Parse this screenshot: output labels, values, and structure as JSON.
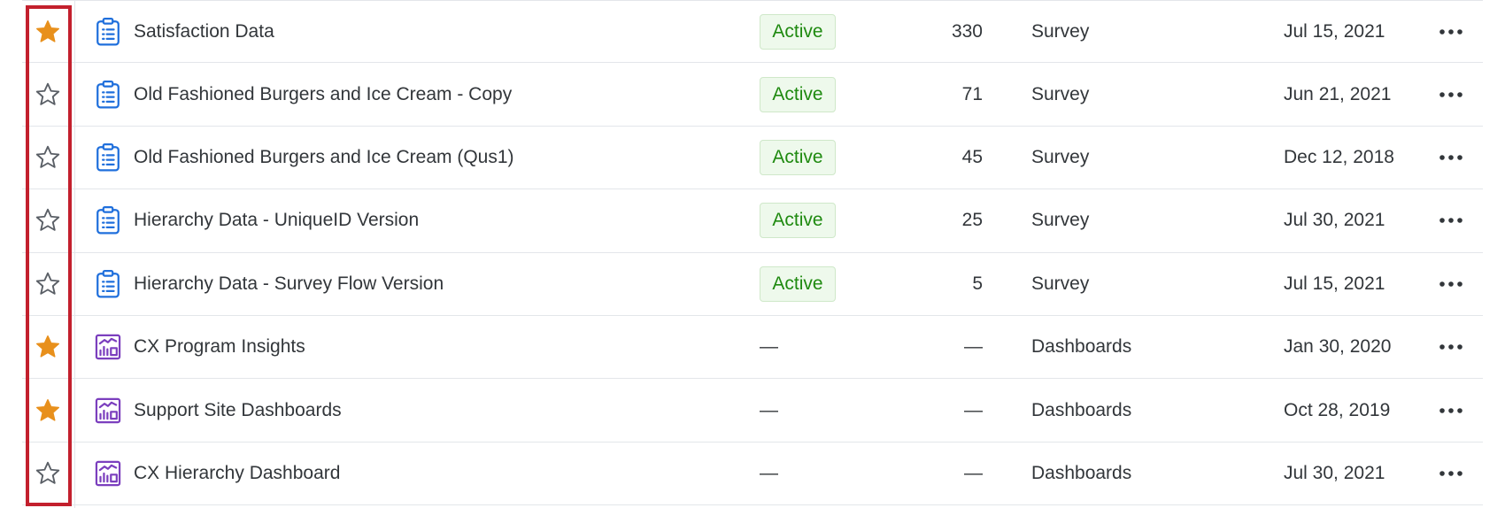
{
  "colors": {
    "star_filled": "#e8901c",
    "star_outline": "#5a5f66",
    "survey_icon": "#1f6fdc",
    "dashboard_icon": "#7b3fbe",
    "active_text": "#1f8a10",
    "highlight": "#c3202d"
  },
  "projects": [
    {
      "starred": true,
      "type_icon": "clipboard-icon",
      "name": "Satisfaction Data",
      "status": "Active",
      "responses": "330",
      "kind": "Survey",
      "modified": "Jul 15, 2021"
    },
    {
      "starred": false,
      "type_icon": "clipboard-icon",
      "name": "Old Fashioned Burgers and Ice Cream - Copy",
      "status": "Active",
      "responses": "71",
      "kind": "Survey",
      "modified": "Jun 21, 2021"
    },
    {
      "starred": false,
      "type_icon": "clipboard-icon",
      "name": "Old Fashioned Burgers and Ice Cream (Qus1)",
      "status": "Active",
      "responses": "45",
      "kind": "Survey",
      "modified": "Dec 12, 2018"
    },
    {
      "starred": false,
      "type_icon": "clipboard-icon",
      "name": "Hierarchy Data - UniqueID Version",
      "status": "Active",
      "responses": "25",
      "kind": "Survey",
      "modified": "Jul 30, 2021"
    },
    {
      "starred": false,
      "type_icon": "clipboard-icon",
      "name": "Hierarchy Data - Survey Flow Version",
      "status": "Active",
      "responses": "5",
      "kind": "Survey",
      "modified": "Jul 15, 2021"
    },
    {
      "starred": true,
      "type_icon": "dashboard-icon",
      "name": "CX Program Insights",
      "status": "—",
      "responses": "—",
      "kind": "Dashboards",
      "modified": "Jan 30, 2020"
    },
    {
      "starred": true,
      "type_icon": "dashboard-icon",
      "name": "Support Site Dashboards",
      "status": "—",
      "responses": "—",
      "kind": "Dashboards",
      "modified": "Oct 28, 2019"
    },
    {
      "starred": false,
      "type_icon": "dashboard-icon",
      "name": "CX Hierarchy Dashboard",
      "status": "—",
      "responses": "—",
      "kind": "Dashboards",
      "modified": "Jul 30, 2021"
    }
  ]
}
